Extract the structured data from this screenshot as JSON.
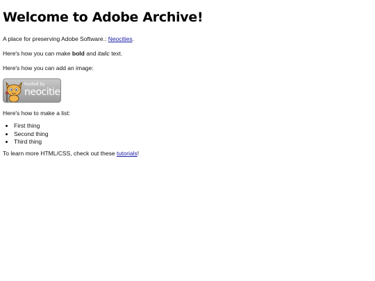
{
  "page": {
    "title": "Welcome to Adobe Archive!",
    "intro_text": "A place for preserving Adobe Software.:",
    "intro_link": "Neocities",
    "intro_end": ".",
    "bold_prefix": "Here's how you can make",
    "bold_word": "bold",
    "bold_and": "and",
    "italic_word": "italic",
    "bold_suffix": "text.",
    "image_text": "Here's how you can add an image:",
    "badge": {
      "hosted_text": "hosted by",
      "brand_text": "neocities"
    },
    "list_intro": "Here's how to make a list:",
    "list_items": [
      "First thing",
      "Second thing",
      "Third thing"
    ],
    "learn_prefix": "To learn more HTML/CSS, check out these",
    "learn_link": "tutorials",
    "learn_end": "!"
  },
  "colors": {
    "link": "#1a1aa6",
    "text": "#111111",
    "background": "#ffffff"
  }
}
